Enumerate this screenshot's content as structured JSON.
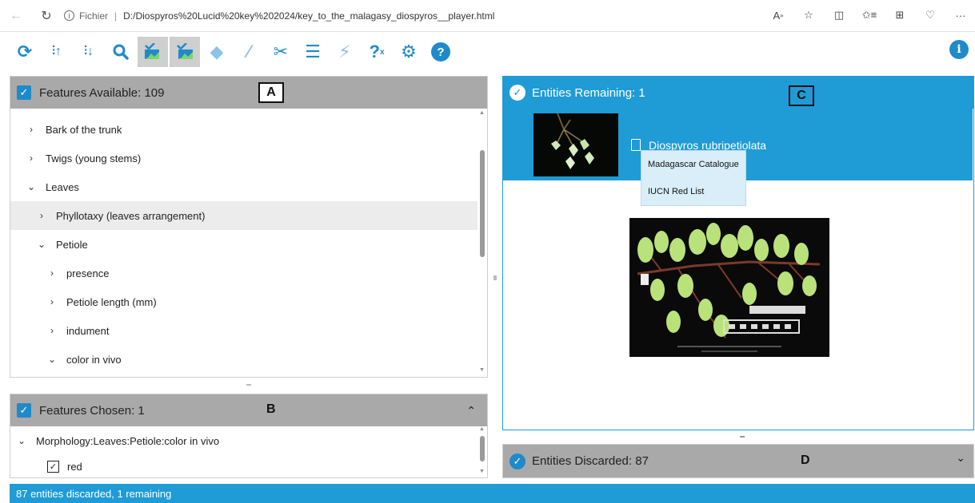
{
  "browser": {
    "scheme_label": "Fichier",
    "separator": "|",
    "url": "D:/Diospyros%20Lucid%20key%202024/key_to_the_malagasy_diospyros__player.html",
    "icons": [
      "back-icon",
      "reload-icon",
      "info-icon",
      "read-aloud-icon",
      "favorite-icon",
      "split-screen-icon",
      "favorites-list-icon",
      "collections-icon",
      "extensions-icon",
      "more-icon"
    ]
  },
  "toolbar": {
    "icons": [
      "restart-icon",
      "sort-ascending-icon",
      "sort-descending-icon",
      "search-icon",
      "image-select-icon",
      "image-select-alt-icon",
      "diamond-icon",
      "magic-wand-icon",
      "scissors-icon",
      "list-icon",
      "filter-icon",
      "help-keys-icon",
      "settings-icon",
      "help-icon"
    ],
    "info_label": "i"
  },
  "panel_a": {
    "title": "Features Available: 109",
    "badge": "A",
    "items": [
      {
        "label": "Bark of the trunk",
        "chevron": "›",
        "indent": 0,
        "highlight": false
      },
      {
        "label": "Twigs (young stems)",
        "chevron": "›",
        "indent": 0,
        "highlight": false
      },
      {
        "label": "Leaves",
        "chevron": "⌄",
        "indent": 0,
        "highlight": false
      },
      {
        "label": "Phyllotaxy (leaves arrangement)",
        "chevron": "›",
        "indent": 1,
        "highlight": true
      },
      {
        "label": "Petiole",
        "chevron": "⌄",
        "indent": 1,
        "highlight": false
      },
      {
        "label": "presence",
        "chevron": "›",
        "indent": 2,
        "highlight": false
      },
      {
        "label": "Petiole length (mm)",
        "chevron": "›",
        "indent": 2,
        "highlight": false
      },
      {
        "label": "indument",
        "chevron": "›",
        "indent": 2,
        "highlight": false
      },
      {
        "label": "color in vivo",
        "chevron": "⌄",
        "indent": 2,
        "highlight": false
      }
    ]
  },
  "panel_b": {
    "title": "Features Chosen: 1",
    "badge": "B",
    "collapse": "⌃",
    "path": "Morphology:Leaves:Petiole:color in vivo",
    "chevron": "⌄",
    "choice": "red",
    "choice_check": "✓"
  },
  "panel_c": {
    "title": "Entities Remaining: 1",
    "badge": "C",
    "entity_name": "Diospyros rubripetiolata",
    "menu": [
      "Madagascar Catalogue",
      "IUCN Red List"
    ]
  },
  "panel_d": {
    "title": "Entities Discarded: 87",
    "badge": "D",
    "expand": "⌄"
  },
  "status": "87 entities discarded, 1 remaining",
  "colors": {
    "accent": "#1f9bd6",
    "header_gray": "#a9a9a9"
  }
}
